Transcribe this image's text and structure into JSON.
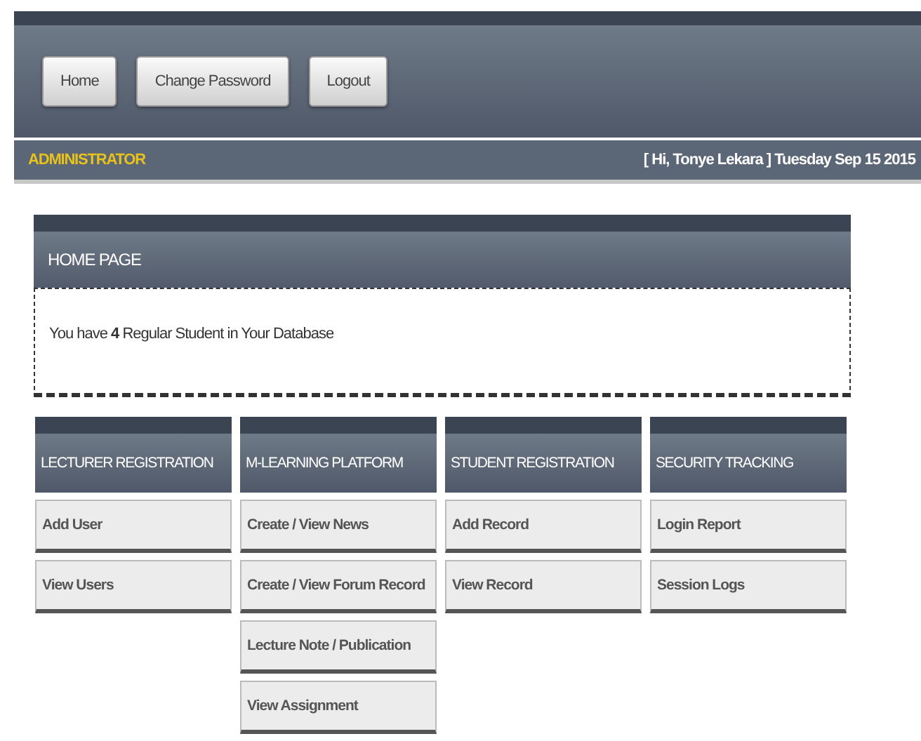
{
  "nav_buttons": [
    "Home",
    "Change Password",
    "Logout"
  ],
  "role_label": "ADMINISTRATOR",
  "greeting": "[ Hi, Tonye Lekara ] Tuesday Sep 15 2015",
  "home_panel": {
    "title": "HOME PAGE",
    "message": "You have **4** Regular Student in Your Database"
  },
  "menus": [
    {
      "title": "LECTURER REGISTRATION",
      "items": [
        "Add User",
        "View Users"
      ]
    },
    {
      "title": "M-LEARNING PLATFORM",
      "items": [
        "Create / View News",
        "Create / View Forum Record",
        "Lecture Note / Publication",
        "View Assignment"
      ]
    },
    {
      "title": "STUDENT REGISTRATION",
      "items": [
        "Add Record",
        "View Record"
      ]
    },
    {
      "title": "SECURITY TRACKING",
      "items": [
        "Login Report",
        "Session Logs"
      ]
    }
  ]
}
